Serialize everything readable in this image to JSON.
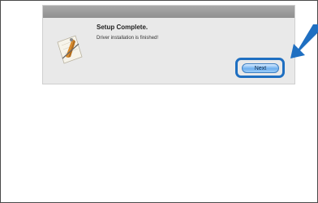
{
  "dialog": {
    "heading": "Setup Complete.",
    "message": "Driver installation is finished!",
    "next_label": "Next"
  },
  "icons": {
    "app": "installer-app-icon",
    "pointer": "arrow-pointer-icon"
  },
  "colors": {
    "highlight": "#1f6fc1",
    "button": "#6fb0ef",
    "dialog_bg": "#e9e9e9"
  }
}
